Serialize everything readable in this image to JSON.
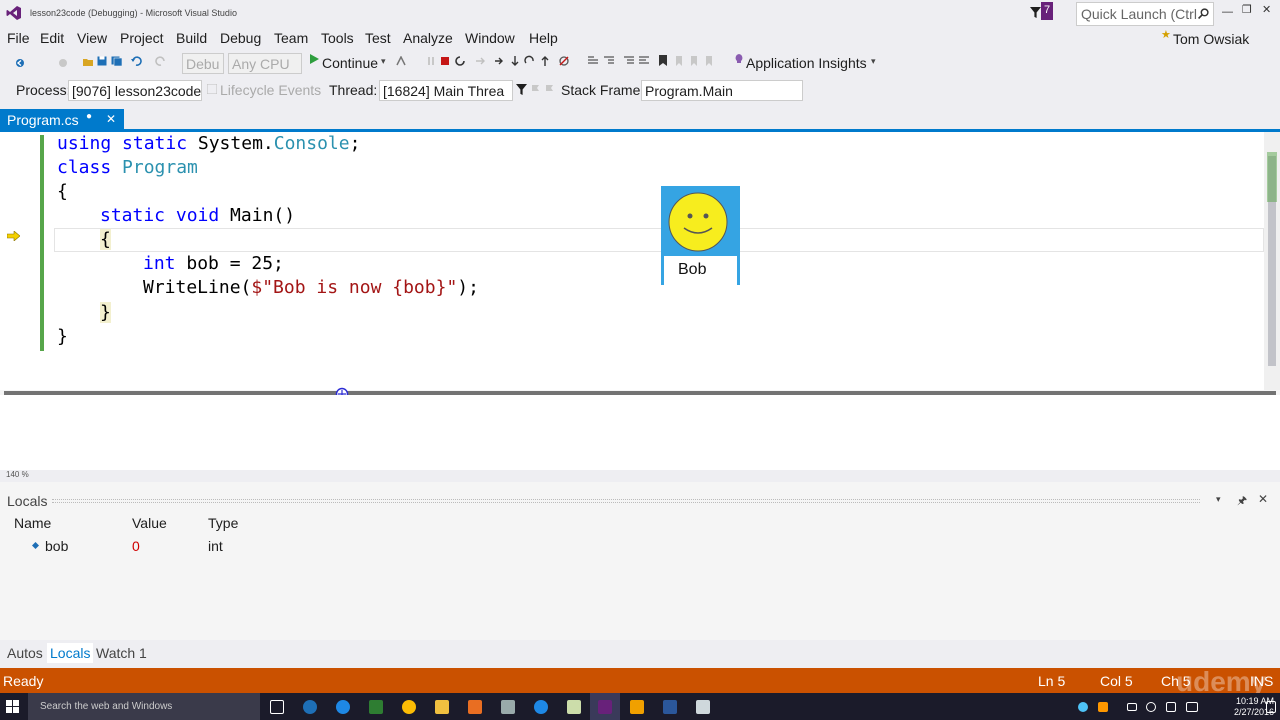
{
  "window": {
    "title": "lesson23code (Debugging) - Microsoft Visual Studio",
    "notification_count": "7",
    "quick_launch_placeholder": "Quick Launch (Ctrl",
    "user": "Tom Owsiak"
  },
  "menu": [
    "File",
    "Edit",
    "View",
    "Project",
    "Build",
    "Debug",
    "Team",
    "Tools",
    "Test",
    "Analyze",
    "Window",
    "Help"
  ],
  "toolbar": {
    "config": "Debu",
    "platform": "Any CPU",
    "continue_label": "Continue",
    "insights_label": "Application Insights"
  },
  "debug_location": {
    "process_label": "Process:",
    "process_value": "[9076] lesson23code",
    "lifecycle_label": "Lifecycle Events",
    "thread_label": "Thread:",
    "thread_value": "[16824] Main Threa",
    "stackframe_label": "Stack Frame:",
    "stackframe_value": "Program.Main"
  },
  "tab": {
    "label": "Program.cs"
  },
  "code": {
    "l1_kw": "using static",
    "l1_rest": " System.",
    "l1_type": "Console",
    "l1_end": ";",
    "l2_kw": "class",
    "l2_type": "Program",
    "l3": "{",
    "l4_kw": "static void",
    "l4_rest": " Main()",
    "l5": "{",
    "l6_kw": "int",
    "l6_rest": " bob = 25;",
    "l7_pre": "WriteLine(",
    "l7_str": "$\"Bob is now {bob}\"",
    "l7_end": ");",
    "l8": "}",
    "l9": "}"
  },
  "zoom_level": "140 %",
  "locals": {
    "title": "Locals",
    "columns": [
      "Name",
      "Value",
      "Type"
    ],
    "rows": [
      {
        "name": "bob",
        "value": "0",
        "type": "int"
      }
    ]
  },
  "bottom_tabs": [
    "Autos",
    "Locals",
    "Watch 1"
  ],
  "status": {
    "state": "Ready",
    "ln": "Ln 5",
    "col": "Col 5",
    "ch": "Ch 5",
    "mode": "INS"
  },
  "taskbar": {
    "search_placeholder": "Search the web and Windows",
    "time": "10:19 AM",
    "date": "2/27/2016"
  },
  "overlay": {
    "name": "Bob",
    "watermark": "udemy"
  },
  "colors": {
    "accent": "#007acc",
    "status_bar": "#ca5100",
    "keyword": "#0000ff",
    "type": "#2b91af",
    "string": "#a31515",
    "value_changed": "#d00000"
  }
}
